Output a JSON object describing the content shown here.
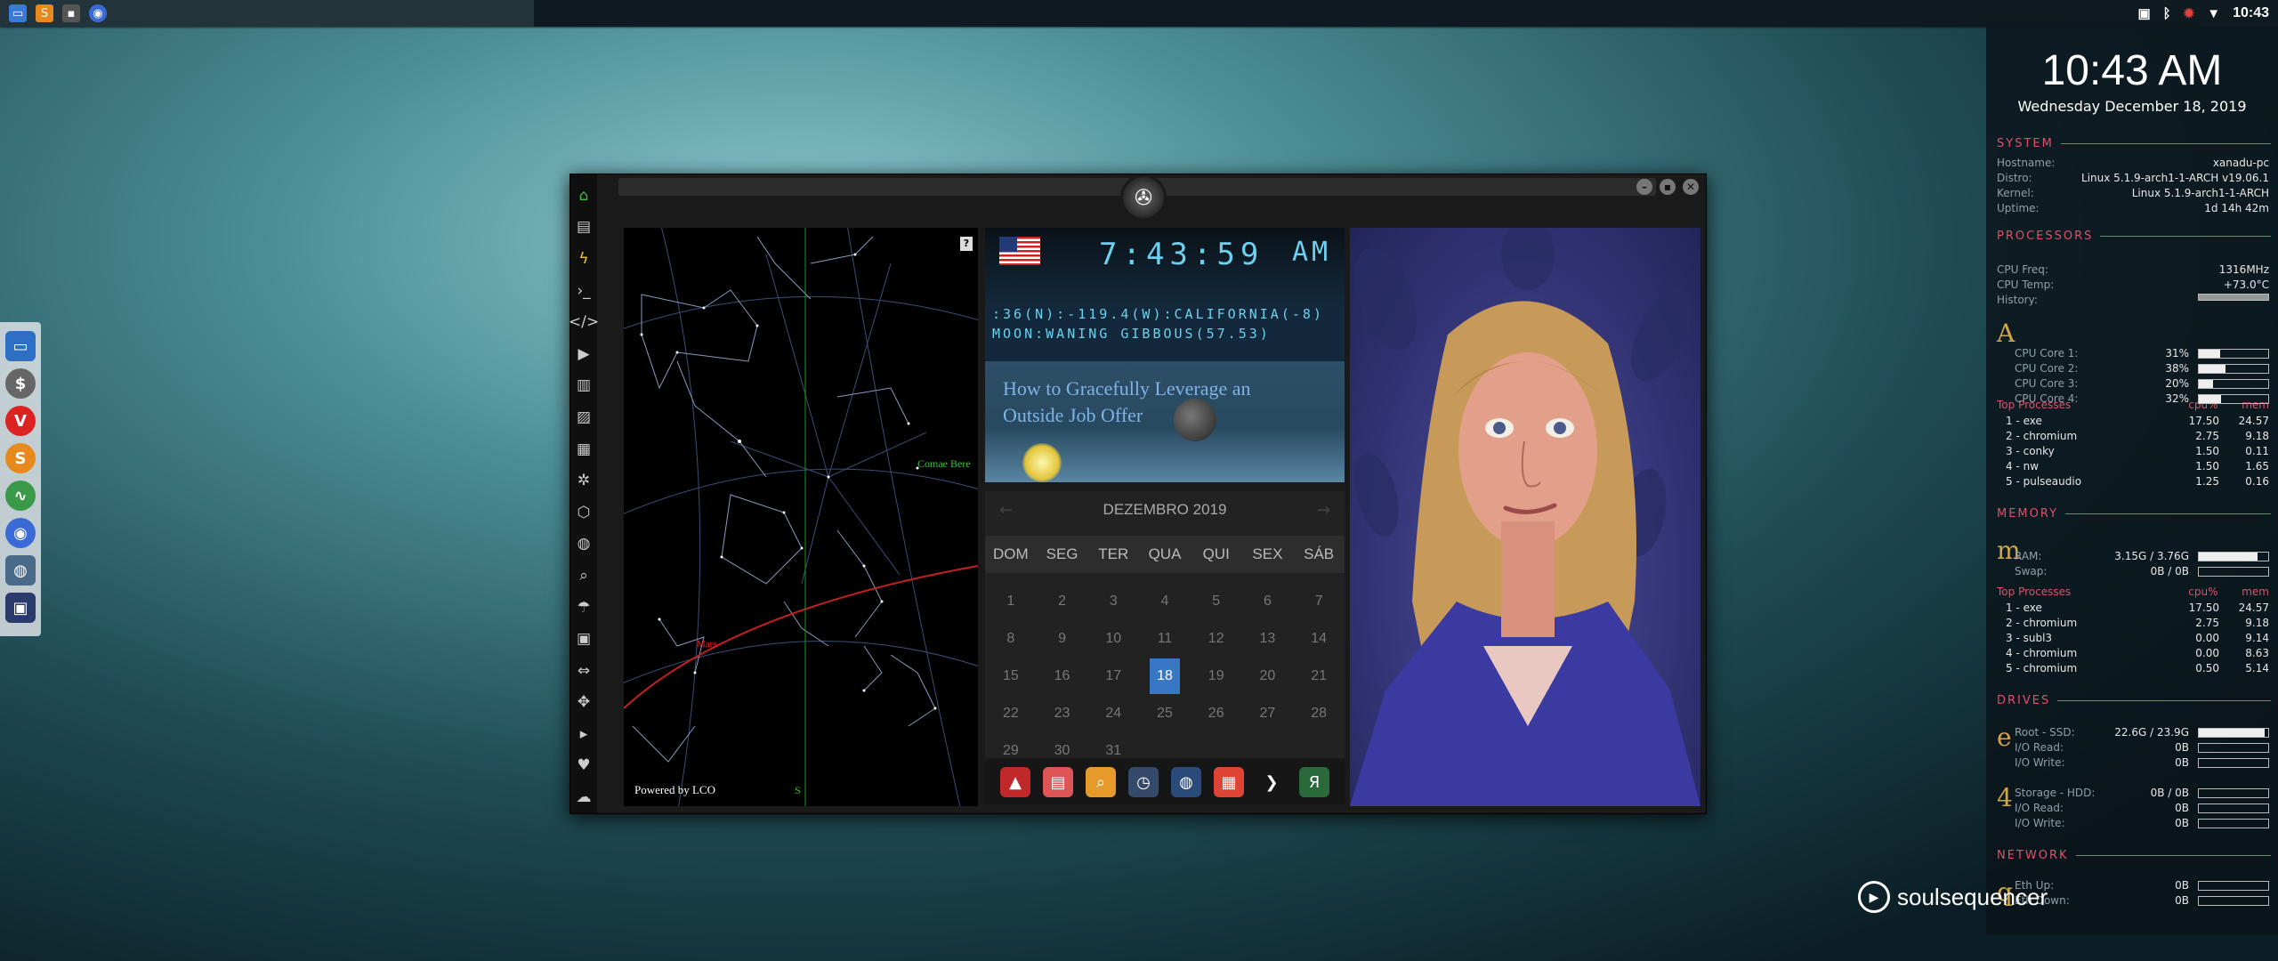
{
  "topbar": {
    "time": "10:43",
    "task_icons": [
      "files-icon",
      "sublime-icon",
      "terminal-icon",
      "chromium-icon"
    ]
  },
  "dock": {
    "icons": [
      "window-manager-icon",
      "dollar-icon",
      "vivaldi-icon",
      "sublime-text-icon",
      "pulse-icon",
      "chromium-icon",
      "globe-icon",
      "screenshot-icon"
    ]
  },
  "window": {
    "sidebar_icons": [
      "home-icon",
      "document-icon",
      "bolt-icon",
      "terminal-icon",
      "code-icon",
      "play-icon",
      "book-icon",
      "image-icon",
      "news-icon",
      "gear-icon",
      "network-icon",
      "globe-icon",
      "search-icon",
      "umbrella-icon",
      "contact-icon",
      "link-icon",
      "expand-icon",
      "youtube-icon",
      "heart-icon",
      "cloud-icon"
    ],
    "controls": {
      "minimize": "–",
      "maximize": "▪",
      "close": "✕"
    }
  },
  "skymap": {
    "help": "?",
    "credit": "Powered by LCO",
    "label_coma": "Comae Bere",
    "label_mars": "Mars",
    "label_s": "S"
  },
  "clock": {
    "time": "7:43:59",
    "ampm": "AM",
    "coords": ":36(N):-119.4(W):CALIFORNIA(-8)",
    "moon": "MOON:WANING GIBBOUS(57.53)"
  },
  "headline": "How to Gracefully Leverage an Outside Job Offer",
  "calendar": {
    "title": "DEZEMBRO 2019",
    "prev": "←",
    "next": "→",
    "weekdays": [
      "DOM",
      "SEG",
      "TER",
      "QUA",
      "QUI",
      "SEX",
      "SÁB"
    ],
    "days": [
      "1",
      "2",
      "3",
      "4",
      "5",
      "6",
      "7",
      "8",
      "9",
      "10",
      "11",
      "12",
      "13",
      "14",
      "15",
      "16",
      "17",
      "18",
      "19",
      "20",
      "21",
      "22",
      "23",
      "24",
      "25",
      "26",
      "27",
      "28",
      "29",
      "30",
      "31"
    ],
    "today": "18"
  },
  "launcher": [
    {
      "name": "arch-icon",
      "color": "#c0282a",
      "glyph": "▲"
    },
    {
      "name": "calendar-app-icon",
      "color": "#d55",
      "glyph": "▤"
    },
    {
      "name": "search-app-icon",
      "color": "#e69a2a",
      "glyph": "⌕"
    },
    {
      "name": "clock-app-icon",
      "color": "#334a6a",
      "glyph": "◷"
    },
    {
      "name": "web-app-icon",
      "color": "#2a4a7a",
      "glyph": "◍"
    },
    {
      "name": "calendar-active-icon",
      "color": "#d43",
      "glyph": "▦"
    },
    {
      "name": "arrow-app-icon",
      "color": "#161616",
      "glyph": "❯"
    },
    {
      "name": "yandex-app-icon",
      "color": "#2a6a3a",
      "glyph": "Я"
    }
  ],
  "conky": {
    "time": "10:43 AM",
    "date": "Wednesday December 18, 2019",
    "system_title": "SYSTEM",
    "system": [
      {
        "label": "Hostname:",
        "value": "xanadu-pc"
      },
      {
        "label": "Distro:",
        "value": "Linux 5.1.9-arch1-1-ARCH v19.06.1"
      },
      {
        "label": "Kernel:",
        "value": "Linux 5.1.9-arch1-1-ARCH"
      },
      {
        "label": "Uptime:",
        "value": "1d 14h 42m"
      }
    ],
    "processors_title": "PROCESSORS",
    "cpu": [
      {
        "label": "CPU Freq:",
        "value": "1316MHz"
      },
      {
        "label": "CPU Temp:",
        "value": "+73.0°C"
      },
      {
        "label": "History:",
        "value": ""
      }
    ],
    "cpu_letter": "A",
    "cores": [
      {
        "label": "CPU Core 1:",
        "value": "31%",
        "fill": 0.31
      },
      {
        "label": "CPU Core 2:",
        "value": "38%",
        "fill": 0.38
      },
      {
        "label": "CPU Core 3:",
        "value": "20%",
        "fill": 0.2
      },
      {
        "label": "CPU Core 4:",
        "value": "32%",
        "fill": 0.32
      }
    ],
    "proc_header": {
      "title": "Top Processes",
      "cpu": "cpu%",
      "mem": "mem"
    },
    "top_cpu": [
      {
        "name": "1  -  exe",
        "cpu": "17.50",
        "mem": "24.57"
      },
      {
        "name": "2  -  chromium",
        "cpu": "2.75",
        "mem": "9.18"
      },
      {
        "name": "3  -  conky",
        "cpu": "1.50",
        "mem": "0.11"
      },
      {
        "name": "4  -  nw",
        "cpu": "1.50",
        "mem": "1.65"
      },
      {
        "name": "5  -  pulseaudio",
        "cpu": "1.25",
        "mem": "0.16"
      }
    ],
    "memory_title": "MEMORY",
    "mem_letter": "m",
    "memory": [
      {
        "label": "RAM:",
        "value": "3.15G / 3.76G",
        "fill": 0.84
      },
      {
        "label": "Swap:",
        "value": "0B / 0B",
        "fill": 0
      }
    ],
    "top_mem": [
      {
        "name": "1  -  exe",
        "cpu": "17.50",
        "mem": "24.57"
      },
      {
        "name": "2  -  chromium",
        "cpu": "2.75",
        "mem": "9.18"
      },
      {
        "name": "3  -  subl3",
        "cpu": "0.00",
        "mem": "9.14"
      },
      {
        "name": "4  -  chromium",
        "cpu": "0.00",
        "mem": "8.63"
      },
      {
        "name": "5  -  chromium",
        "cpu": "0.50",
        "mem": "5.14"
      }
    ],
    "drives_title": "DRIVES",
    "drive_letter": "e",
    "drive1": [
      {
        "label": "Root - SSD:",
        "value": "22.6G / 23.9G",
        "fill": 0.95
      },
      {
        "label": "I/O Read:",
        "value": "0B",
        "fill": 0
      },
      {
        "label": "I/O Write:",
        "value": "0B",
        "fill": 0
      }
    ],
    "drive2_letter": "4",
    "drive2": [
      {
        "label": "Storage - HDD:",
        "value": "0B / 0B",
        "fill": 0
      },
      {
        "label": "I/O Read:",
        "value": "0B",
        "fill": 0
      },
      {
        "label": "I/O Write:",
        "value": "0B",
        "fill": 0
      }
    ],
    "network_title": "NETWORK",
    "net_letter": "q",
    "network": [
      {
        "label": "Eth Up:",
        "value": "0B",
        "fill": 0
      },
      {
        "label": "Eth Down:",
        "value": "0B",
        "fill": 0
      }
    ]
  },
  "brand": "soulsequencer"
}
